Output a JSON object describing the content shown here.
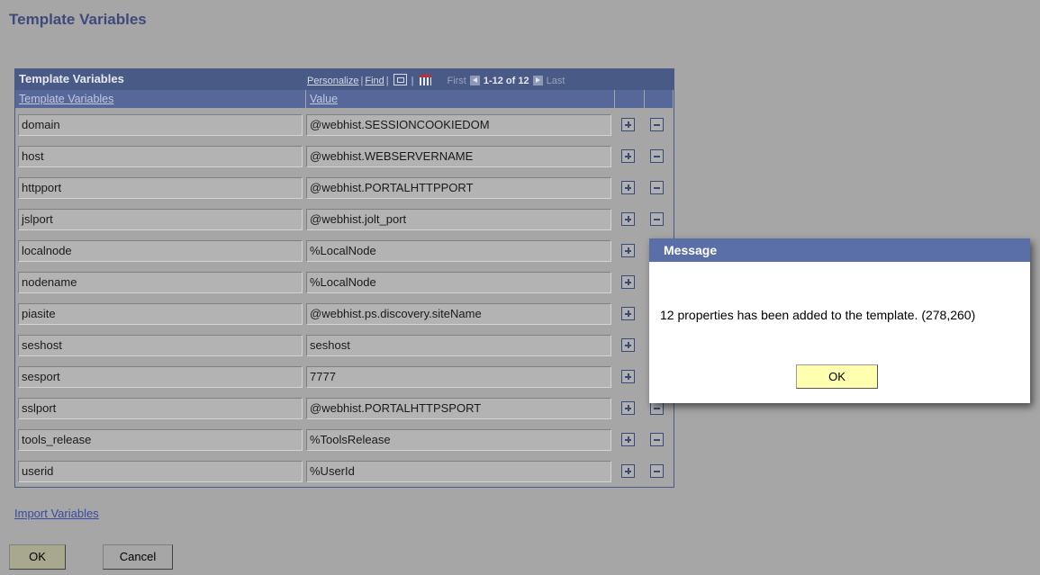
{
  "page": {
    "title": "Template Variables"
  },
  "grid": {
    "title": "Template Variables",
    "nav": {
      "personalize": "Personalize",
      "find": "Find",
      "first": "First",
      "range": "1-12 of 12",
      "last": "Last"
    },
    "columns": [
      "Template Variables",
      "Value"
    ],
    "rows": [
      {
        "name": "domain",
        "value": "@webhist.SESSIONCOOKIEDOM"
      },
      {
        "name": "host",
        "value": "@webhist.WEBSERVERNAME"
      },
      {
        "name": "httpport",
        "value": "@webhist.PORTALHTTPPORT"
      },
      {
        "name": "jslport",
        "value": "@webhist.jolt_port"
      },
      {
        "name": "localnode",
        "value": "%LocalNode"
      },
      {
        "name": "nodename",
        "value": "%LocalNode"
      },
      {
        "name": "piasite",
        "value": "@webhist.ps.discovery.siteName"
      },
      {
        "name": "seshost",
        "value": "seshost"
      },
      {
        "name": "sesport",
        "value": "7777"
      },
      {
        "name": "sslport",
        "value": "@webhist.PORTALHTTPSPORT"
      },
      {
        "name": "tools_release",
        "value": "%ToolsRelease"
      },
      {
        "name": "userid",
        "value": "%UserId"
      }
    ],
    "row_icons": {
      "add": "plus-icon",
      "delete": "minus-icon"
    }
  },
  "import_link": "Import Variables",
  "buttons": {
    "ok": "OK",
    "cancel": "Cancel"
  },
  "dialog": {
    "title": "Message",
    "message": "12 properties has been added to the template. (278,260)",
    "ok": "OK"
  },
  "colors": {
    "overlay_gray": "#a6a6a6",
    "grid_header": "#4a5a86",
    "dialog_title_bar": "#5a6fa8",
    "dialog_ok_button": "#ffffb0"
  }
}
